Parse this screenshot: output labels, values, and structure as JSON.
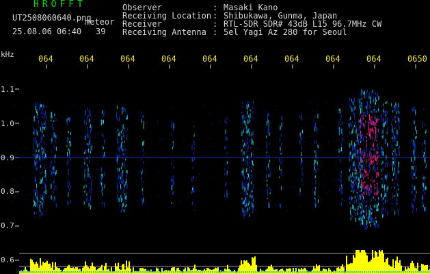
{
  "header": {
    "app_name": "HROFFT",
    "file_name": "UT2508060640.png",
    "type_label": "meteor",
    "date_time": "25.08.06 06:40",
    "count": "39"
  },
  "info": [
    {
      "label": "Observer",
      "value": "Masaki Kano"
    },
    {
      "label": "Receiving Location",
      "value": "Shibukawa, Gunma, Japan"
    },
    {
      "label": "Receiver",
      "value": "RTL-SDR SDR# 43dB L15 96.7MHz CW"
    },
    {
      "label": "Receiving Antenna",
      "value": "5el Yagi Az 280 for Seoul"
    }
  ],
  "axis": {
    "unit": "kHz",
    "y_ticks": [
      "1.1",
      "1.0",
      "0.9",
      "0.8",
      "0.7",
      "0.6"
    ],
    "x_ticks": [
      "064",
      "064",
      "064",
      "064",
      "064",
      "064",
      "064",
      "064",
      "064",
      "0650"
    ]
  },
  "colors": {
    "background": "#000000",
    "signal_low": "#1030c0",
    "signal_mid": "#20d0d0",
    "signal_high": "#ff2070",
    "bottom_bars": "#ffff00",
    "tick_text": "#f0e040",
    "header_app": "#00e000"
  }
}
